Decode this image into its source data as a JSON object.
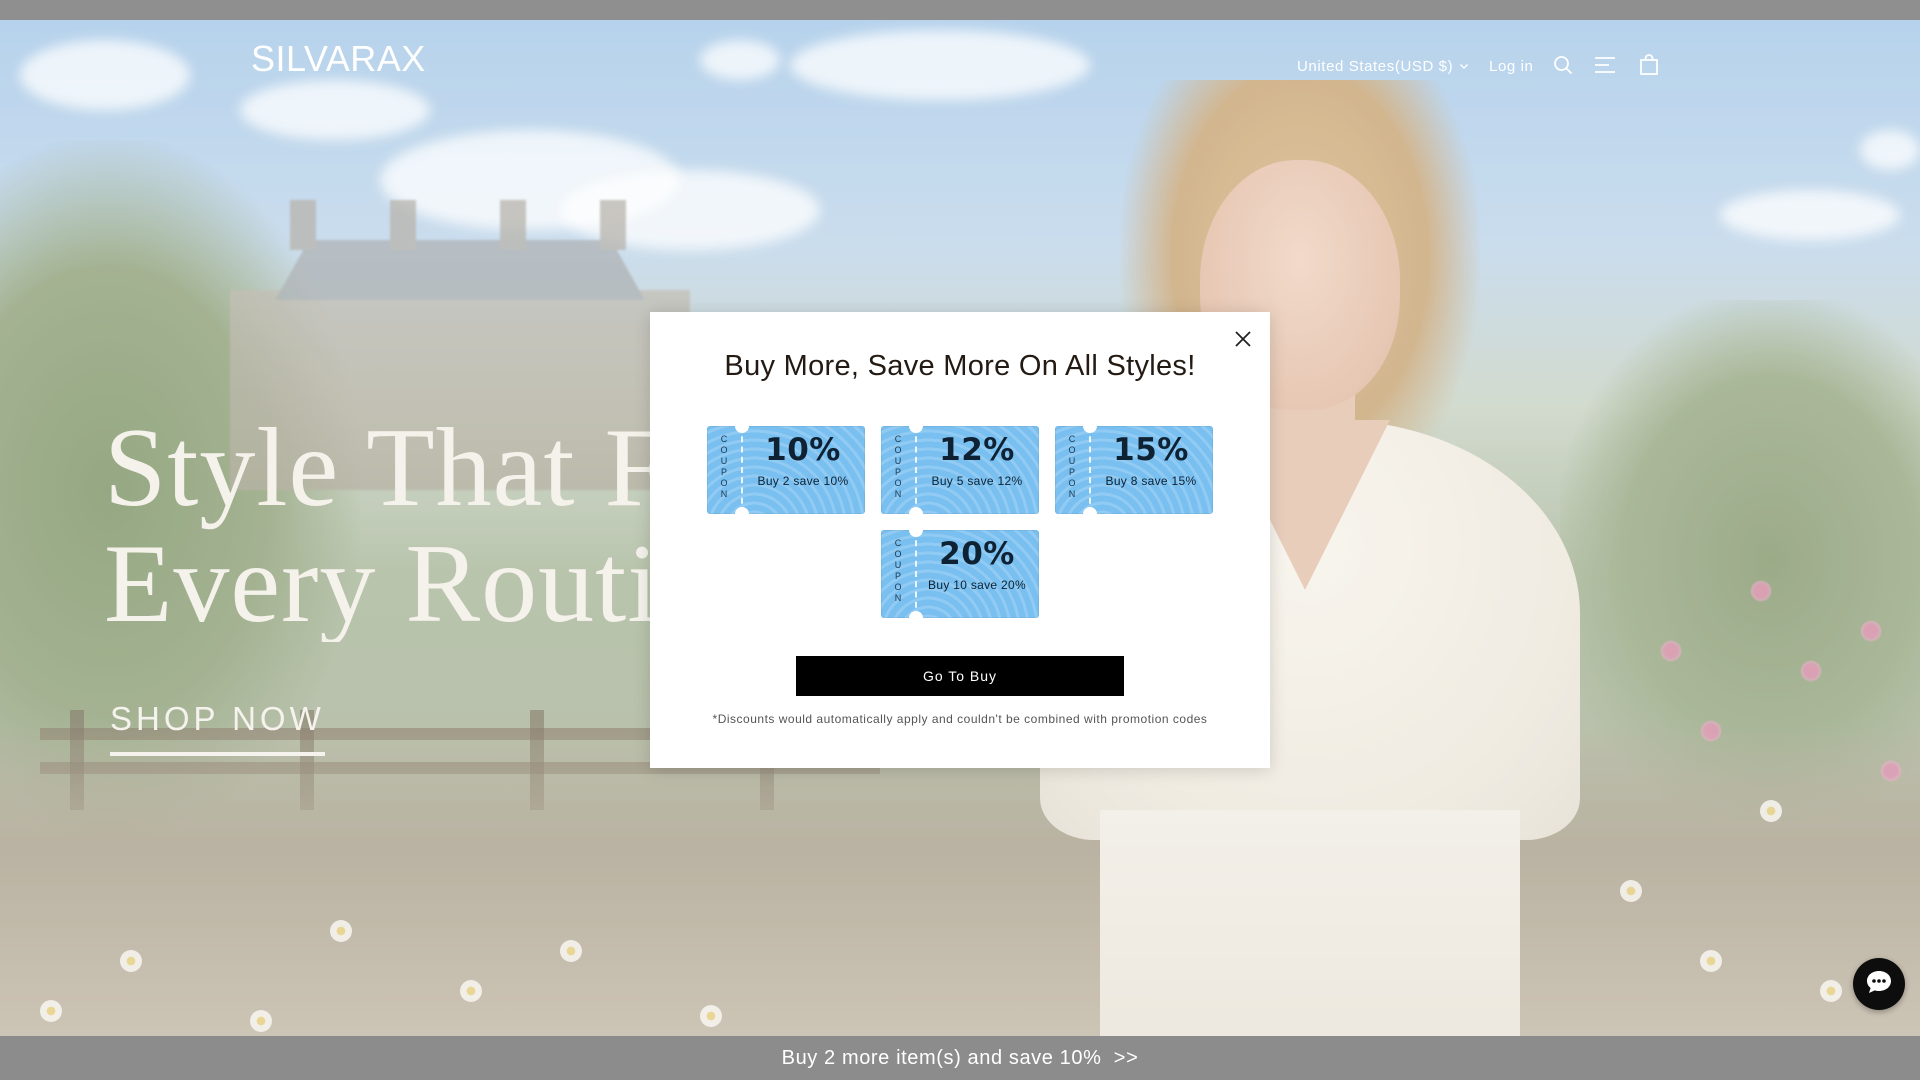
{
  "header": {
    "logo": "SILVARAX",
    "currency": "United States(USD $)",
    "login": "Log in",
    "icons": [
      "search-icon",
      "menu-icon",
      "cart-icon"
    ]
  },
  "hero": {
    "title_line1": "Style That Fi",
    "title_line2": "Every Routine",
    "cta": "SHOP NOW"
  },
  "modal": {
    "title": "Buy More, Save More On All Styles!",
    "coupon_label": "COUPON",
    "coupons": [
      {
        "percent": "10%",
        "desc": "Buy 2 save 10%"
      },
      {
        "percent": "12%",
        "desc": "Buy 5 save 12%"
      },
      {
        "percent": "15%",
        "desc": "Buy 8 save 15%"
      },
      {
        "percent": "20%",
        "desc": "Buy 10 save 20%"
      }
    ],
    "button": "Go To Buy",
    "note": "*Discounts would automatically apply and couldn't be combined with promotion codes"
  },
  "promo_bar": {
    "text": "Buy 2 more item(s) and save 10%  >>"
  },
  "colors": {
    "coupon_blue": "#79bff0",
    "button_black": "#000000",
    "promo_bar_gray": "#8c8c8c"
  }
}
